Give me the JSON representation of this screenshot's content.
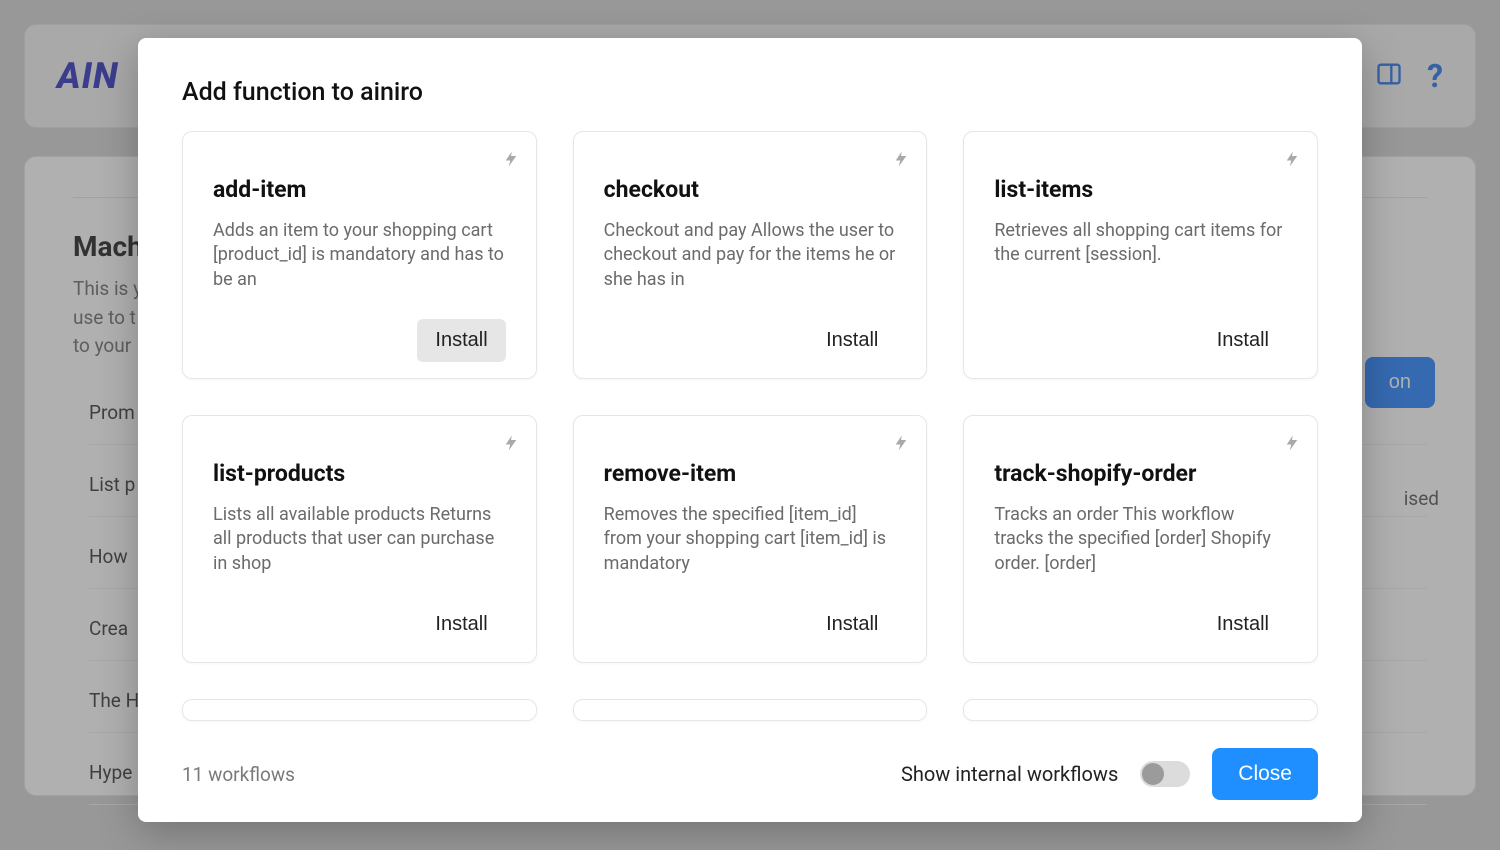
{
  "background": {
    "logo": "AIN",
    "help": "?",
    "title": "Machi",
    "desc_line1": "This is y",
    "desc_line2": "use to t",
    "desc_line3": "to your",
    "button_tail": "on",
    "right_tail": "ised",
    "side_items": [
      "Prom",
      "List p",
      "How",
      "Crea",
      "The H",
      "Hype"
    ]
  },
  "modal": {
    "title": "Add function to ainiro",
    "workflow_count": "11 workflows",
    "toggle_label": "Show internal workflows",
    "close_label": "Close",
    "install_label": "Install",
    "functions": [
      {
        "name": "add-item",
        "desc": "Adds an item to your shopping cart [product_id] is mandatory and has to be an",
        "hover": true
      },
      {
        "name": "checkout",
        "desc": "Checkout and pay Allows the user to checkout and pay for the items he or she has in",
        "hover": false
      },
      {
        "name": "list-items",
        "desc": "Retrieves all shopping cart items for the current [session].",
        "hover": false
      },
      {
        "name": "list-products",
        "desc": "Lists all available products Returns all products that user can purchase in shop",
        "hover": false
      },
      {
        "name": "remove-item",
        "desc": "Removes the specified [item_id] from your shopping cart [item_id] is mandatory",
        "hover": false
      },
      {
        "name": "track-shopify-order",
        "desc": "Tracks an order This workflow tracks the specified [order] Shopify order. [order]",
        "hover": false
      }
    ]
  }
}
